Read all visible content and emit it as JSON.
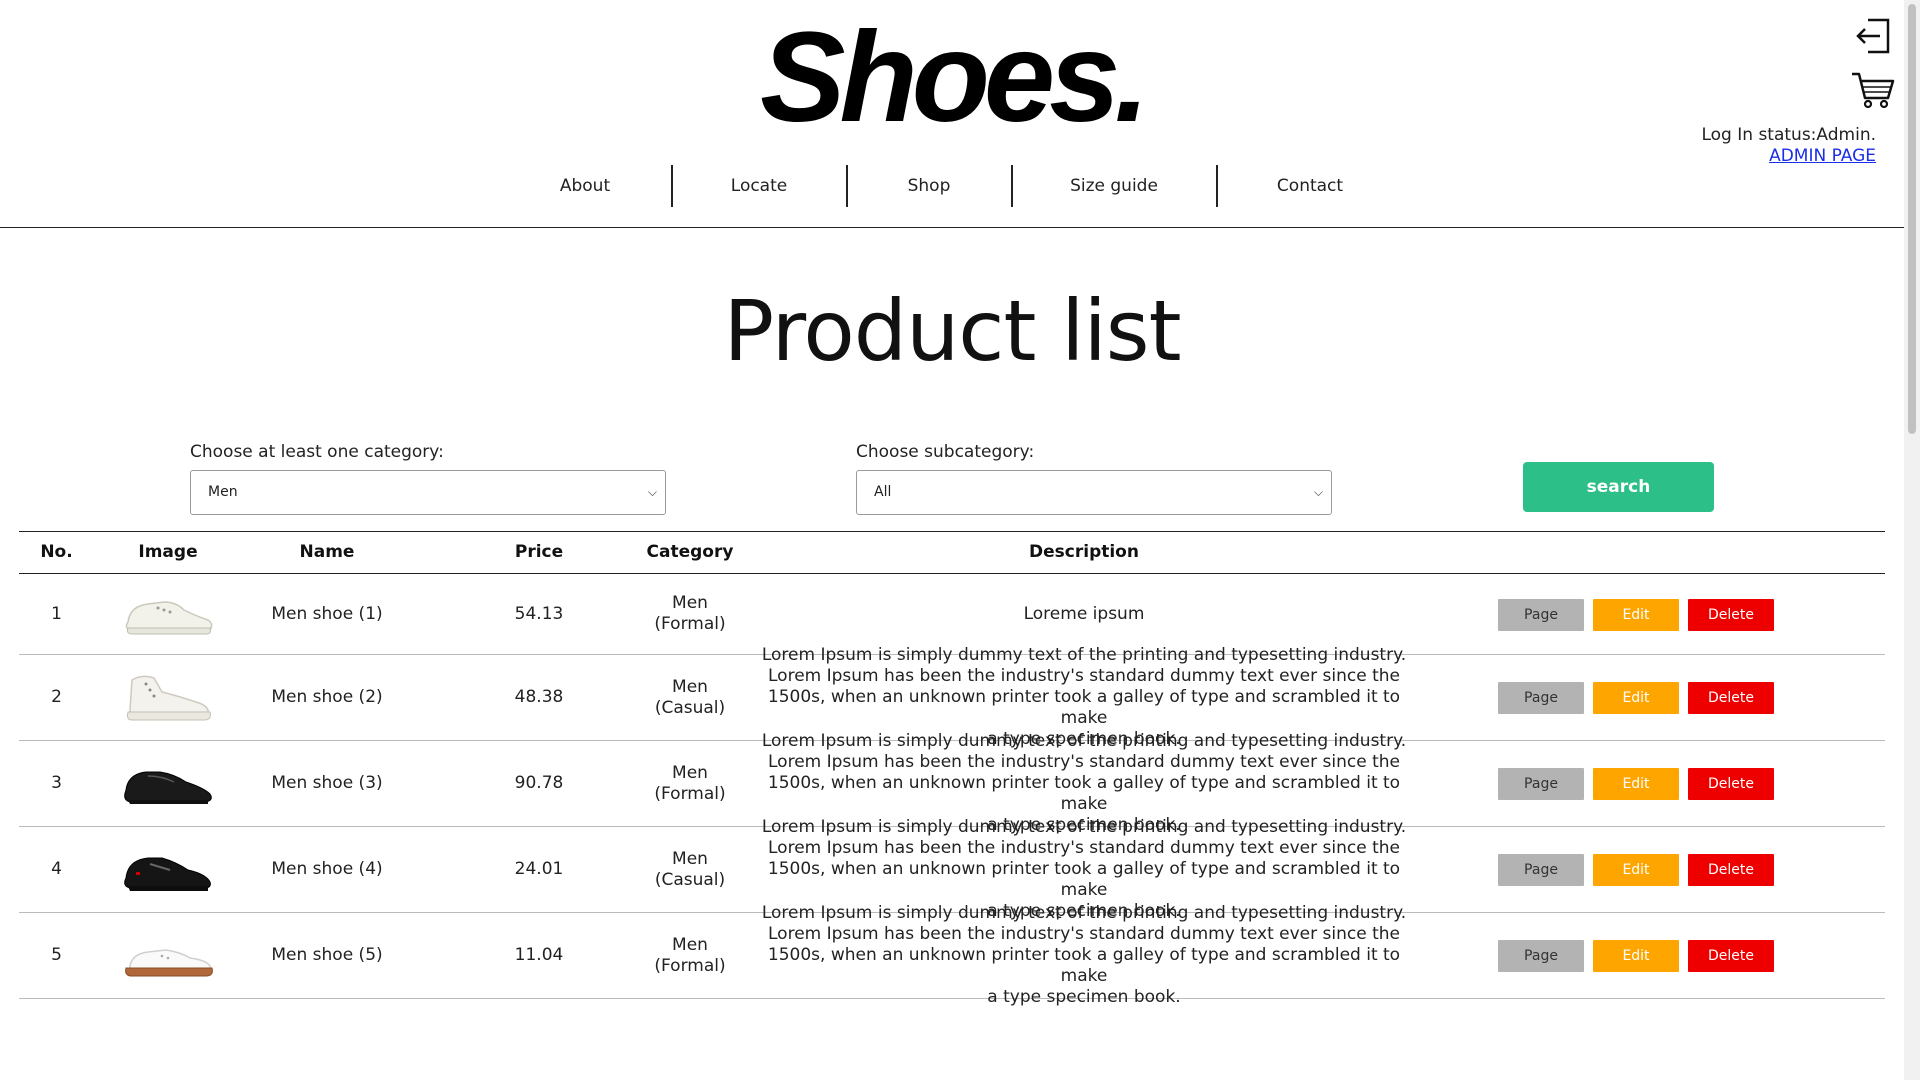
{
  "brand": {
    "logo": "Shoes."
  },
  "nav": [
    {
      "label": "About"
    },
    {
      "label": "Locate"
    },
    {
      "label": "Shop"
    },
    {
      "label": "Size guide"
    },
    {
      "label": "Contact"
    }
  ],
  "account": {
    "login_status": "Log In status:Admin.",
    "admin_link": "ADMIN PAGE",
    "icons": [
      "logout-icon",
      "cart-icon"
    ]
  },
  "page_title": "Product list",
  "filters": {
    "category_label": "Choose at least one category:",
    "category_value": "Men",
    "subcategory_label": "Choose subcategory:",
    "subcategory_value": "All",
    "search_label": "search"
  },
  "table": {
    "headers": [
      "No.",
      "Image",
      "Name",
      "Price",
      "Category",
      "Description"
    ],
    "action_labels": {
      "page": "Page",
      "edit": "Edit",
      "delete": "Delete"
    },
    "rows": [
      {
        "no": "1",
        "image": "white-sneaker",
        "name": "Men shoe (1)",
        "price": "54.13",
        "category": "Men",
        "subcategory": "(Formal)",
        "description": [
          "Loreme ipsum"
        ]
      },
      {
        "no": "2",
        "image": "white-high-top",
        "name": "Men shoe (2)",
        "price": "48.38",
        "category": "Men",
        "subcategory": "(Casual)",
        "description": [
          "Lorem Ipsum is simply dummy text of the printing and typesetting industry.",
          "Lorem Ipsum has been the industry's standard dummy text ever since the",
          "1500s, when an unknown printer took a galley of type and scrambled it to make",
          "a type specimen book."
        ]
      },
      {
        "no": "3",
        "image": "black-formal",
        "name": "Men shoe (3)",
        "price": "90.78",
        "category": "Men",
        "subcategory": "(Formal)",
        "description": [
          "Lorem Ipsum is simply dummy text of the printing and typesetting industry.",
          "Lorem Ipsum has been the industry's standard dummy text ever since the",
          "1500s, when an unknown printer took a galley of type and scrambled it to make",
          "a type specimen book."
        ]
      },
      {
        "no": "4",
        "image": "black-casual",
        "name": "Men shoe (4)",
        "price": "24.01",
        "category": "Men",
        "subcategory": "(Casual)",
        "description": [
          "Lorem Ipsum is simply dummy text of the printing and typesetting industry.",
          "Lorem Ipsum has been the industry's standard dummy text ever since the",
          "1500s, when an unknown printer took a galley of type and scrambled it to make",
          "a type specimen book."
        ]
      },
      {
        "no": "5",
        "image": "white-gum-sneaker",
        "name": "Men shoe (5)",
        "price": "11.04",
        "category": "Men",
        "subcategory": "(Formal)",
        "description": [
          "Lorem Ipsum is simply dummy text of the printing and typesetting industry.",
          "Lorem Ipsum has been the industry's standard dummy text ever since the",
          "1500s, when an unknown printer took a galley of type and scrambled it to make",
          "a type specimen book."
        ]
      }
    ]
  },
  "colors": {
    "search_button": "#2dbf88",
    "page_button": "#b3b3b3",
    "edit_button": "#ffa500",
    "delete_button": "#ee0000",
    "admin_link": "#1a2ee8"
  }
}
